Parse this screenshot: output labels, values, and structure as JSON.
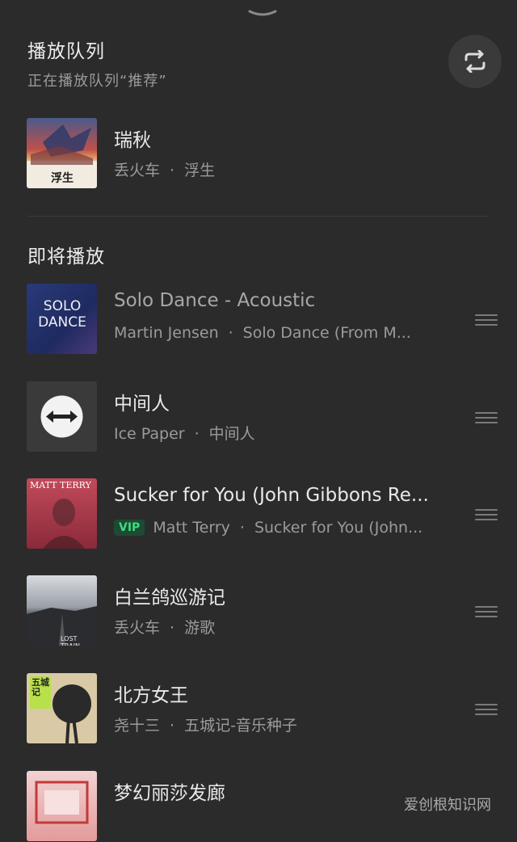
{
  "header": {
    "title": "播放队列",
    "subtitle": "正在播放队列“推荐”"
  },
  "current": {
    "title": "瑞秋",
    "artist": "丢火车",
    "album": "浮生",
    "cover_text": "浮生"
  },
  "upcoming": {
    "section_title": "即将播放",
    "items": [
      {
        "title": "Solo Dance - Acoustic",
        "artist": "Martin Jensen",
        "album": "Solo Dance (From M...",
        "cover_text": "SOLO DANCE"
      },
      {
        "title": "中间人",
        "artist": "Ice Paper",
        "album": "中间人"
      },
      {
        "title": "Sucker for You (John Gibbons Re...",
        "artist": "Matt Terry",
        "album": "Sucker for You (John...",
        "vip": "VIP",
        "cover_text": "MATT TERRY"
      },
      {
        "title": "白兰鸽巡游记",
        "artist": "丢火车",
        "album": "游歌",
        "cover_text": "LOST TRAIN"
      },
      {
        "title": "北方女王",
        "artist": "尧十三",
        "album": "五城记-音乐种子",
        "cover_text": "五城记"
      },
      {
        "title": "梦幻丽莎发廊",
        "artist": "",
        "album": ""
      }
    ]
  },
  "watermark": "爱创根知识网",
  "colors": {
    "background": "#2b2b2b",
    "vip_green": "#3ddc84"
  }
}
